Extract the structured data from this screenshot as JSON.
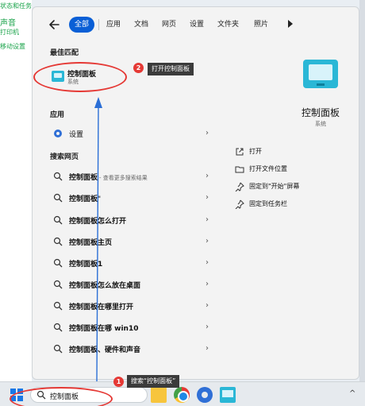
{
  "background": {
    "lines": [
      "状态和任务",
      "声音",
      "打印机",
      "移动设置"
    ]
  },
  "filters": {
    "back_icon": "arrow-left-icon",
    "chips": [
      {
        "label": "全部",
        "active": true
      },
      {
        "label": "应用",
        "active": false
      },
      {
        "label": "文档",
        "active": false
      },
      {
        "label": "网页",
        "active": false
      },
      {
        "label": "设置",
        "active": false
      },
      {
        "label": "文件夹",
        "active": false
      },
      {
        "label": "照片",
        "active": false
      }
    ],
    "more_icon": "play-right-icon"
  },
  "best_match": {
    "section_title": "最佳匹配",
    "title": "控制面板",
    "subtitle": "系统"
  },
  "apps": {
    "section_title": "应用",
    "items": [
      {
        "label": "设置",
        "icon": "gear-icon"
      }
    ]
  },
  "web": {
    "section_title": "搜索网页",
    "items": [
      {
        "bold": "控制面板",
        "rest": "",
        "hint": "- 查看更多搜索结果"
      },
      {
        "bold": "控制面板",
        "rest": "\"",
        "hint": ""
      },
      {
        "bold": "控制面板怎么打开",
        "rest": "",
        "hint": ""
      },
      {
        "bold": "控制面板主页",
        "rest": "",
        "hint": ""
      },
      {
        "bold": "控制面板1",
        "rest": "",
        "hint": ""
      },
      {
        "bold": "控制面板怎么放在桌面",
        "rest": "",
        "hint": ""
      },
      {
        "bold": "控制面板在哪里打开",
        "rest": "",
        "hint": ""
      },
      {
        "bold": "控制面板在哪 win10",
        "rest": "",
        "hint": ""
      },
      {
        "bold": "控制面板、硬件和声音",
        "rest": "",
        "hint": ""
      }
    ]
  },
  "preview": {
    "title": "控制面板",
    "subtitle": "系统",
    "actions": [
      {
        "label": "打开",
        "icon": "open-external-icon"
      },
      {
        "label": "打开文件位置",
        "icon": "folder-icon"
      },
      {
        "label": "固定到\"开始\"屏幕",
        "icon": "pin-icon"
      },
      {
        "label": "固定到任务栏",
        "icon": "pin-icon"
      }
    ]
  },
  "taskbar": {
    "search_text": "控制面板",
    "apps": [
      "file-explorer-icon",
      "chrome-icon",
      "settings-app-icon",
      "control-panel-icon"
    ],
    "tray_caret": "^"
  },
  "annotations": {
    "step1": {
      "number": "1",
      "text": "搜索“控制面板”"
    },
    "step2": {
      "number": "2",
      "text": "打开控制面板"
    },
    "color": "#e53935"
  },
  "colors": {
    "accent": "#0a5fd6",
    "control_panel": "#2ab7d6",
    "background_text": "#1aa34a"
  }
}
